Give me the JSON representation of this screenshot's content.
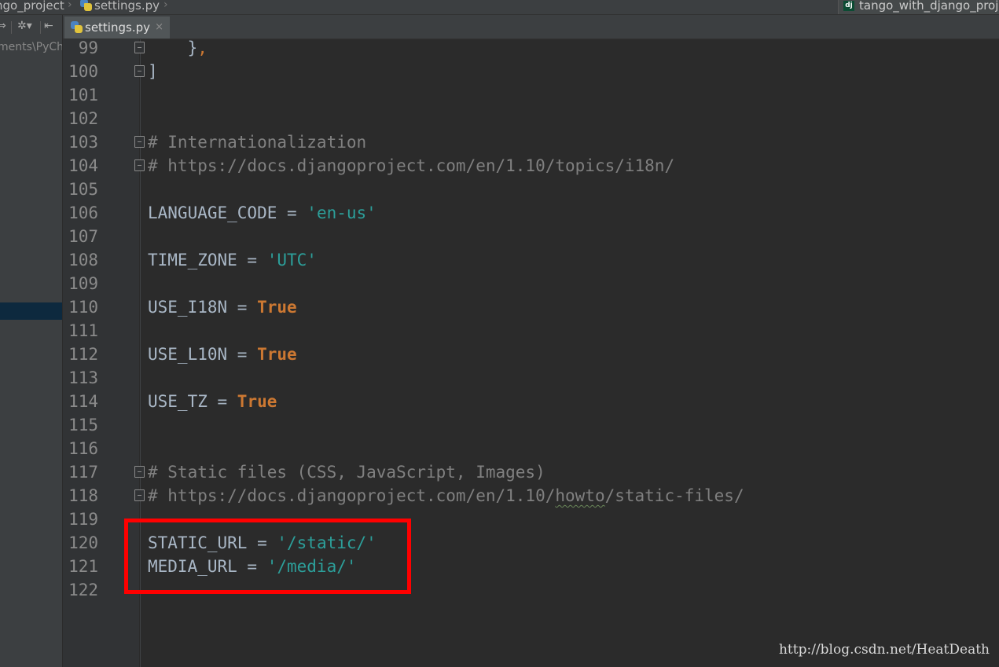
{
  "navbar": {
    "crumbs": [
      "ngo_project",
      "settings.py"
    ],
    "right_tab": "tango_with_django_proj",
    "right_tab_badge": "dj"
  },
  "project_panel": {
    "toolbar_icons": [
      "collapse-icon",
      "gear-icon",
      "hide-icon"
    ],
    "path_text": "ments\\PyCh"
  },
  "editor_tab": {
    "label": "settings.py",
    "close": "×"
  },
  "code": {
    "lines": [
      {
        "num": "99",
        "fold": true,
        "tokens": [
          {
            "t": "    }",
            "c": "t-default"
          },
          {
            "t": ",",
            "c": "t-punct"
          }
        ]
      },
      {
        "num": "100",
        "fold": true,
        "tokens": [
          {
            "t": "]",
            "c": "t-default"
          }
        ]
      },
      {
        "num": "101",
        "fold": false,
        "tokens": []
      },
      {
        "num": "102",
        "fold": false,
        "tokens": []
      },
      {
        "num": "103",
        "fold": true,
        "tokens": [
          {
            "t": "# Internationalization",
            "c": "t-comment"
          }
        ]
      },
      {
        "num": "104",
        "fold": true,
        "tokens": [
          {
            "t": "# https://docs.djangoproject.com/en/1.10/topics/i18n/",
            "c": "t-comment"
          }
        ]
      },
      {
        "num": "105",
        "fold": false,
        "tokens": []
      },
      {
        "num": "106",
        "fold": false,
        "tokens": [
          {
            "t": "LANGUAGE_CODE = ",
            "c": "t-default"
          },
          {
            "t": "'en-us'",
            "c": "t-string"
          }
        ]
      },
      {
        "num": "107",
        "fold": false,
        "tokens": []
      },
      {
        "num": "108",
        "fold": false,
        "tokens": [
          {
            "t": "TIME_ZONE = ",
            "c": "t-default"
          },
          {
            "t": "'UTC'",
            "c": "t-string"
          }
        ]
      },
      {
        "num": "109",
        "fold": false,
        "tokens": []
      },
      {
        "num": "110",
        "fold": false,
        "tokens": [
          {
            "t": "USE_I18N = ",
            "c": "t-default"
          },
          {
            "t": "True",
            "c": "t-keyword"
          }
        ]
      },
      {
        "num": "111",
        "fold": false,
        "tokens": []
      },
      {
        "num": "112",
        "fold": false,
        "tokens": [
          {
            "t": "USE_L10N = ",
            "c": "t-default"
          },
          {
            "t": "True",
            "c": "t-keyword"
          }
        ]
      },
      {
        "num": "113",
        "fold": false,
        "tokens": []
      },
      {
        "num": "114",
        "fold": false,
        "tokens": [
          {
            "t": "USE_TZ = ",
            "c": "t-default"
          },
          {
            "t": "True",
            "c": "t-keyword"
          }
        ]
      },
      {
        "num": "115",
        "fold": false,
        "tokens": []
      },
      {
        "num": "116",
        "fold": false,
        "tokens": []
      },
      {
        "num": "117",
        "fold": true,
        "tokens": [
          {
            "t": "# Static files (CSS, JavaScript, Images)",
            "c": "t-comment"
          }
        ]
      },
      {
        "num": "118",
        "fold": true,
        "tokens": [
          {
            "t": "# https://docs.djangoproject.com/en/1.10/",
            "c": "t-comment"
          },
          {
            "t": "howto",
            "c": "t-comment t-spell"
          },
          {
            "t": "/static-files/",
            "c": "t-comment"
          }
        ]
      },
      {
        "num": "119",
        "fold": false,
        "tokens": []
      },
      {
        "num": "120",
        "fold": false,
        "tokens": [
          {
            "t": "STATIC_URL = ",
            "c": "t-default"
          },
          {
            "t": "'/static/'",
            "c": "t-string"
          }
        ]
      },
      {
        "num": "121",
        "fold": false,
        "tokens": [
          {
            "t": "MEDIA_URL = ",
            "c": "t-default"
          },
          {
            "t": "'/media/'",
            "c": "t-string"
          }
        ]
      },
      {
        "num": "122",
        "fold": false,
        "tokens": []
      }
    ]
  },
  "watermark": "http://blog.csdn.net/HeatDeath",
  "colors": {
    "background": "#2b2b2b",
    "comment": "#808080",
    "string": "#2c9f9a",
    "keyword": "#cc7832",
    "highlight_box": "#ff0000"
  }
}
